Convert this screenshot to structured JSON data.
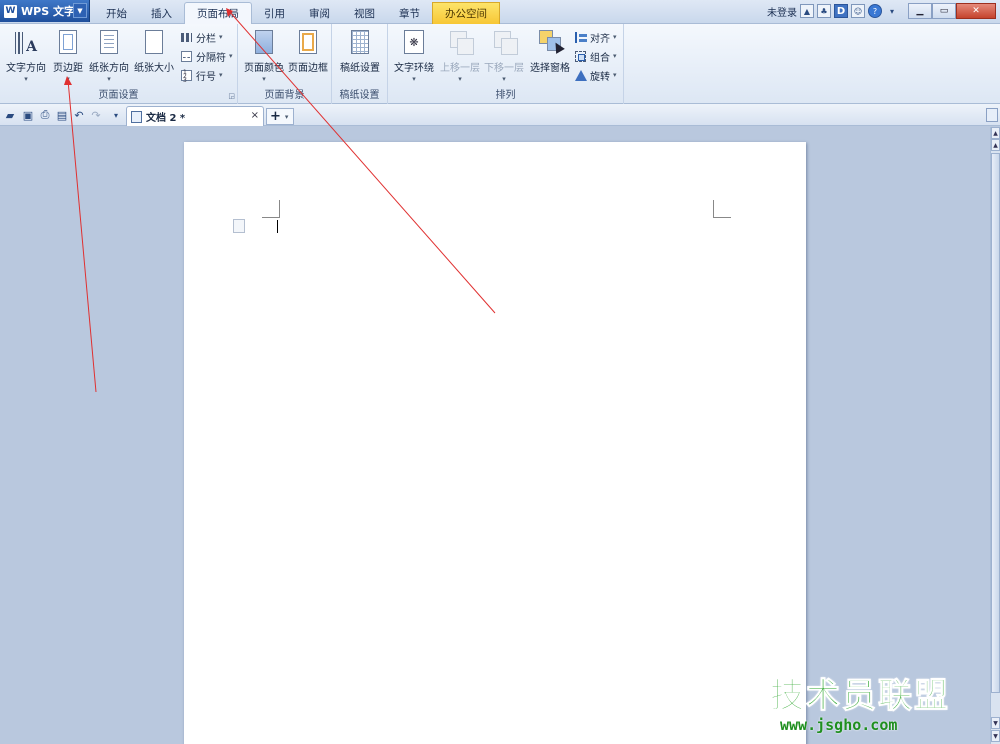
{
  "app": {
    "name": "WPS 文字",
    "logo": "W"
  },
  "tabs": [
    {
      "label": "开始",
      "active": false
    },
    {
      "label": "插入",
      "active": false
    },
    {
      "label": "页面布局",
      "active": true
    },
    {
      "label": "引用",
      "active": false
    },
    {
      "label": "审阅",
      "active": false
    },
    {
      "label": "视图",
      "active": false
    },
    {
      "label": "章节",
      "active": false
    },
    {
      "label": "办公空间",
      "active": false,
      "special": true
    }
  ],
  "title_right": {
    "login": "未登录",
    "d_icon": "D",
    "help": "?"
  },
  "ribbon": {
    "page_setup": {
      "label": "页面设置",
      "text_direction": "文字方向",
      "margins": "页边距",
      "orientation": "纸张方向",
      "size": "纸张大小",
      "columns": "分栏",
      "breaks": "分隔符",
      "line_numbers": "行号"
    },
    "page_background": {
      "label": "页面背景",
      "page_color": "页面颜色",
      "page_border": "页面边框"
    },
    "draft": {
      "label": "稿纸设置",
      "draft_setup": "稿纸设置"
    },
    "arrange": {
      "label": "排列",
      "text_wrap": "文字环绕",
      "bring_forward": "上移一层",
      "send_backward": "下移一层",
      "selection_pane": "选择窗格",
      "align": "对齐",
      "group": "组合",
      "rotate": "旋转"
    }
  },
  "document_tab": {
    "title": "文档 2 *",
    "close": "×"
  },
  "new_tab": {
    "plus": "+",
    "caret": "▾"
  },
  "watermark": {
    "title": "技术员联盟",
    "url": "www.jsgho.com"
  },
  "colors": {
    "accent": "#1f4f9c",
    "annotation_arrow": "#e03030",
    "special_tab": "#f7c735"
  }
}
